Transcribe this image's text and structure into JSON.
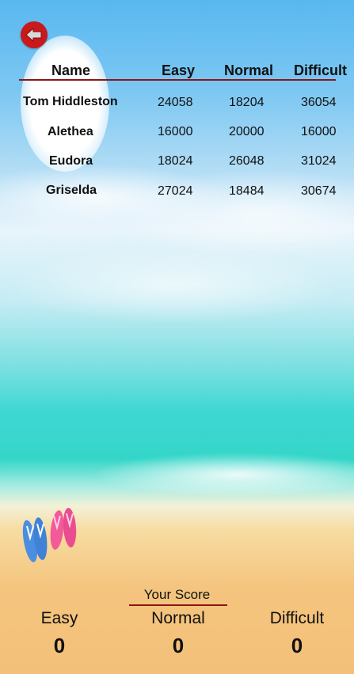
{
  "leaderboard": {
    "headers": {
      "name": "Name",
      "easy": "Easy",
      "normal": "Normal",
      "difficult": "Difficult"
    },
    "rows": [
      {
        "name": "Tom Hiddleston",
        "easy": "24058",
        "normal": "18204",
        "difficult": "36054"
      },
      {
        "name": "Alethea",
        "easy": "16000",
        "normal": "20000",
        "difficult": "16000"
      },
      {
        "name": "Eudora",
        "easy": "18024",
        "normal": "26048",
        "difficult": "31024"
      },
      {
        "name": "Griselda",
        "easy": "27024",
        "normal": "18484",
        "difficult": "30674"
      }
    ]
  },
  "your_score": {
    "title": "Your Score",
    "easy_label": "Easy",
    "normal_label": "Normal",
    "difficult_label": "Difficult",
    "easy_value": "0",
    "normal_value": "0",
    "difficult_value": "0"
  },
  "colors": {
    "accent": "#c8191c",
    "divider": "#8b1414"
  },
  "icons": {
    "back": "back-arrow-icon",
    "decoration": "flip-flops-icon"
  }
}
